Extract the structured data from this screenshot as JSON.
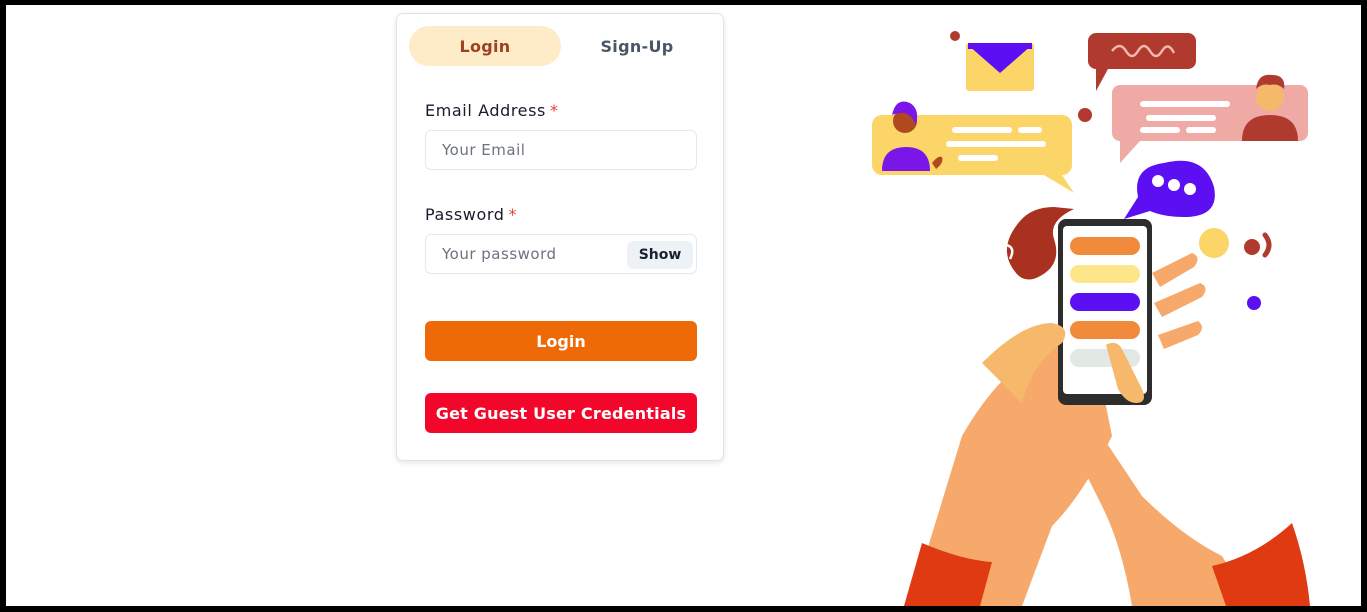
{
  "tabs": {
    "login": "Login",
    "signup": "Sign-Up"
  },
  "form": {
    "email_label": "Email Address",
    "email_placeholder": "Your Email",
    "password_label": "Password",
    "password_placeholder": "Your password",
    "required_mark": "*",
    "show_label": "Show",
    "login_button": "Login",
    "guest_button": "Get Guest User Credentials"
  },
  "colors": {
    "accent_orange": "#ee6a06",
    "guest_red": "#f2072b",
    "active_tab_bg": "#feebc8",
    "active_tab_text": "#9c4221"
  },
  "illustration": {
    "icon": "chat-app-illustration"
  }
}
